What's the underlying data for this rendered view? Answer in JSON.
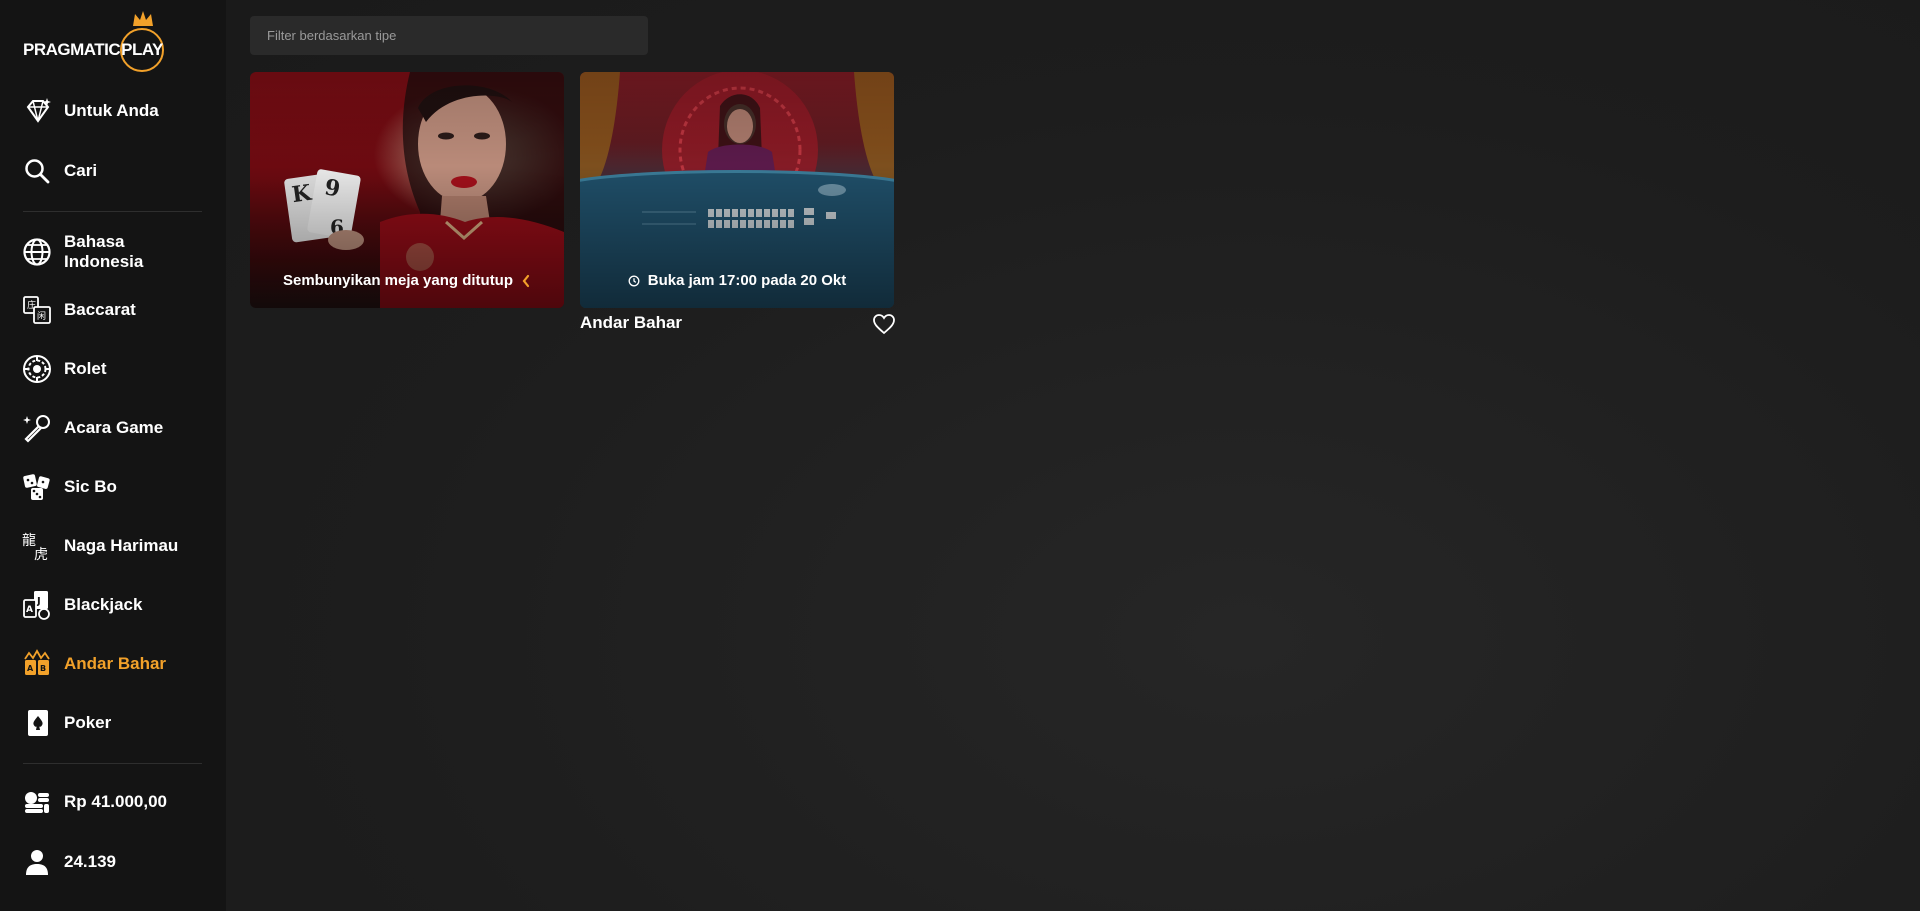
{
  "brand": {
    "logo_text": "PRAGMATIC",
    "logo_play": "PLAY",
    "accent": "#f2a12a"
  },
  "sidebar": {
    "items": [
      {
        "label": "Untuk Anda",
        "icon": "diamond-star-icon"
      },
      {
        "label": "Cari",
        "icon": "search-icon"
      },
      {
        "label": "Bahasa\nIndonesia",
        "icon": "globe-icon"
      },
      {
        "label": "Baccarat",
        "icon": "baccarat-icon"
      },
      {
        "label": "Rolet",
        "icon": "roulette-icon"
      },
      {
        "label": "Acara Game",
        "icon": "microphone-icon"
      },
      {
        "label": "Sic Bo",
        "icon": "dice-icon"
      },
      {
        "label": "Naga Harimau",
        "icon": "dragon-tiger-icon"
      },
      {
        "label": "Blackjack",
        "icon": "blackjack-icon"
      },
      {
        "label": "Andar Bahar",
        "icon": "andar-bahar-icon",
        "active": true
      },
      {
        "label": "Poker",
        "icon": "poker-card-icon"
      }
    ],
    "balance": {
      "label": "Rp 41.000,00",
      "icon": "coins-icon"
    },
    "players": {
      "label": "24.139",
      "icon": "user-icon"
    }
  },
  "main": {
    "filter_placeholder": "Filter berdasarkan tipe",
    "cards": [
      {
        "caption": "Sembunyikan meja yang ditutup",
        "icon": "chevron-left-icon"
      },
      {
        "caption": "Buka jam 17:00 pada 20 Okt",
        "icon": "clock-icon",
        "title": "Andar Bahar"
      }
    ]
  }
}
